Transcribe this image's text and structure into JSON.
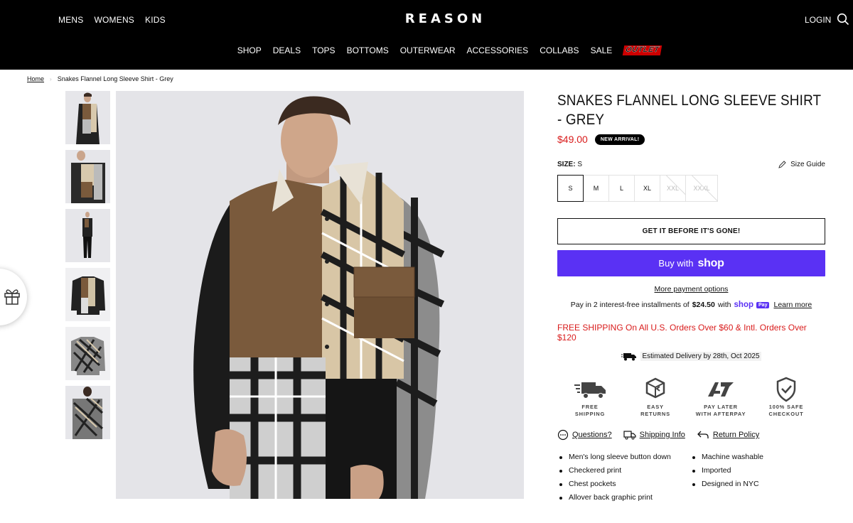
{
  "header": {
    "top_nav": [
      "MENS",
      "WOMENS",
      "KIDS"
    ],
    "logo": "REASON",
    "login": "LOGIN",
    "main_nav": [
      "SHOP",
      "DEALS",
      "TOPS",
      "BOTTOMS",
      "OUTERWEAR",
      "ACCESSORIES",
      "COLLABS",
      "SALE"
    ],
    "outlet": "OUTLET"
  },
  "breadcrumb": {
    "home": "Home",
    "current": "Snakes Flannel Long Sleeve Shirt - Grey"
  },
  "product": {
    "title": "SNAKES FLANNEL LONG SLEEVE SHIRT - GREY",
    "price": "$49.00",
    "badge": "NEW ARRIVAL!",
    "size_label": "SIZE:",
    "size_selected": "S",
    "size_guide": "Size Guide",
    "sizes": [
      "S",
      "M",
      "L",
      "XL",
      "XXL",
      "XXXL"
    ],
    "cta": "GET IT BEFORE IT'S GONE!",
    "buy_with": "Buy with",
    "shop_word": "shop",
    "more_payment": "More payment options",
    "install_pre": "Pay in 2 interest-free installments of",
    "install_amount": "$24.50",
    "install_with": "with",
    "install_brand": "shop",
    "install_pay": "Pay",
    "learn_more": "Learn more",
    "free_shipping": "FREE SHIPPING On All U.S. Orders Over $60 & Intl. Orders Over $120",
    "estimated": "Estimated Delivery by 28th, Oct 2025"
  },
  "badges": [
    {
      "icon": "truck-icon",
      "line1": "FREE",
      "line2": "SHIPPING"
    },
    {
      "icon": "box-return-icon",
      "line1": "EASY",
      "line2": "RETURNS"
    },
    {
      "icon": "afterpay-icon",
      "line1": "PAY LATER",
      "line2": "WITH AFTERPAY"
    },
    {
      "icon": "shield-check-icon",
      "line1": "100% SAFE",
      "line2": "CHECKOUT"
    }
  ],
  "links": {
    "questions": "Questions?",
    "shipping": "Shipping Info",
    "returns": "Return Policy"
  },
  "features": {
    "col1": [
      "Men's long sleeve button down",
      "Checkered print",
      "Chest pockets",
      "Allover back graphic print"
    ],
    "col2": [
      "Machine washable",
      "Imported",
      "Designed in NYC"
    ]
  },
  "colors": {
    "price_red": "#d91c1c",
    "shop_purple": "#5a31f4",
    "header_bg": "#000000"
  }
}
